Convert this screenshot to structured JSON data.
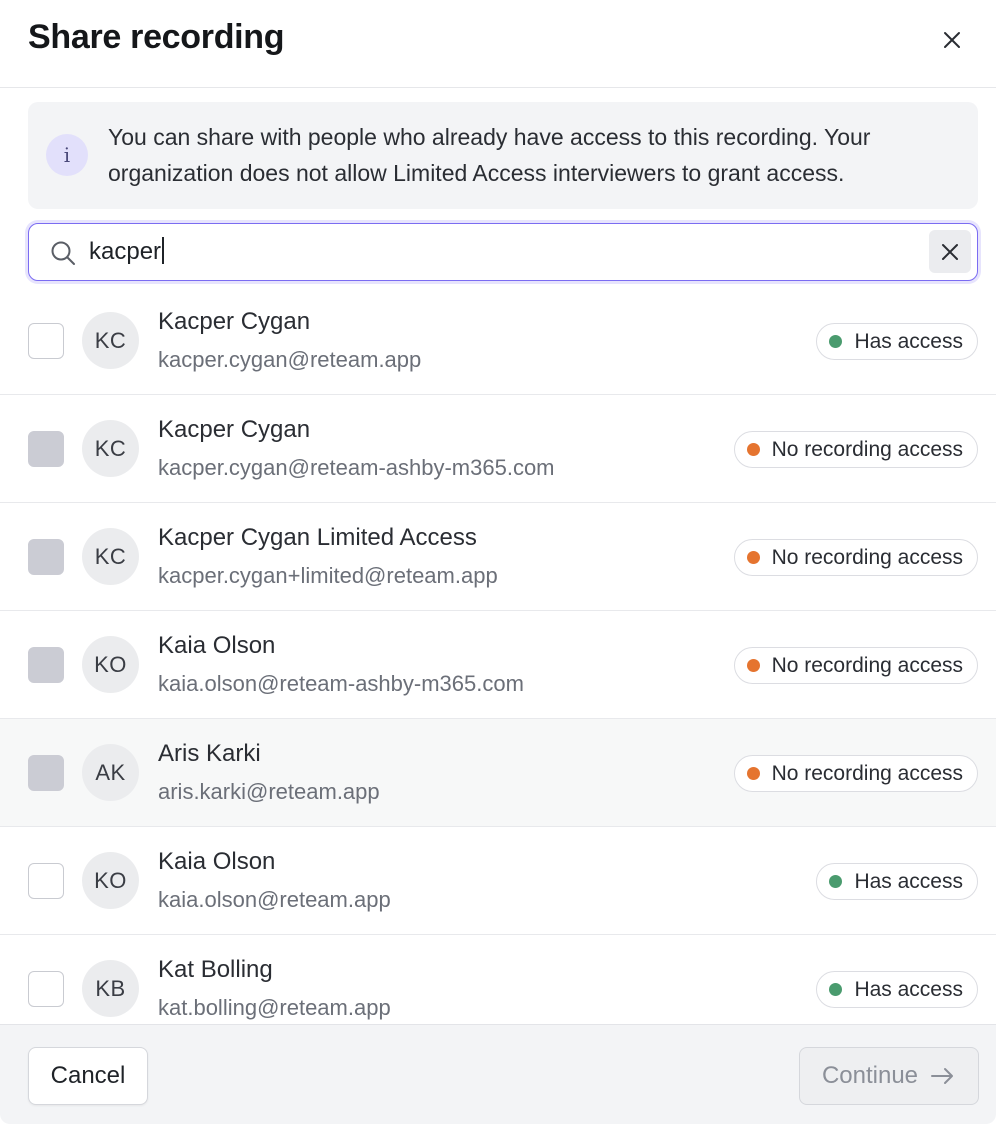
{
  "dialog": {
    "title": "Share recording"
  },
  "info": {
    "text": "You can share with people who already have access to this recording. Your organization does not allow Limited Access interviewers to grant access."
  },
  "search": {
    "value": "kacper"
  },
  "colors": {
    "accent": "#7b6cf2",
    "has_access_dot": "#4a9b6e",
    "no_access_dot": "#e5742f"
  },
  "people": [
    {
      "initials": "KC",
      "name": "Kacper Cygan",
      "email": "kacper.cygan@reteam.app",
      "status": "Has access",
      "status_type": "has",
      "selectable": true
    },
    {
      "initials": "KC",
      "name": "Kacper Cygan",
      "email": "kacper.cygan@reteam-ashby-m365.com",
      "status": "No recording access",
      "status_type": "none",
      "selectable": false
    },
    {
      "initials": "KC",
      "name": "Kacper Cygan Limited Access",
      "email": "kacper.cygan+limited@reteam.app",
      "status": "No recording access",
      "status_type": "none",
      "selectable": false
    },
    {
      "initials": "KO",
      "name": "Kaia Olson",
      "email": "kaia.olson@reteam-ashby-m365.com",
      "status": "No recording access",
      "status_type": "none",
      "selectable": false
    },
    {
      "initials": "AK",
      "name": "Aris Karki",
      "email": "aris.karki@reteam.app",
      "status": "No recording access",
      "status_type": "none",
      "selectable": false
    },
    {
      "initials": "KO",
      "name": "Kaia Olson",
      "email": "kaia.olson@reteam.app",
      "status": "Has access",
      "status_type": "has",
      "selectable": true
    },
    {
      "initials": "KB",
      "name": "Kat Bolling",
      "email": "kat.bolling@reteam.app",
      "status": "Has access",
      "status_type": "has",
      "selectable": true
    }
  ],
  "footer": {
    "cancel_label": "Cancel",
    "continue_label": "Continue"
  }
}
